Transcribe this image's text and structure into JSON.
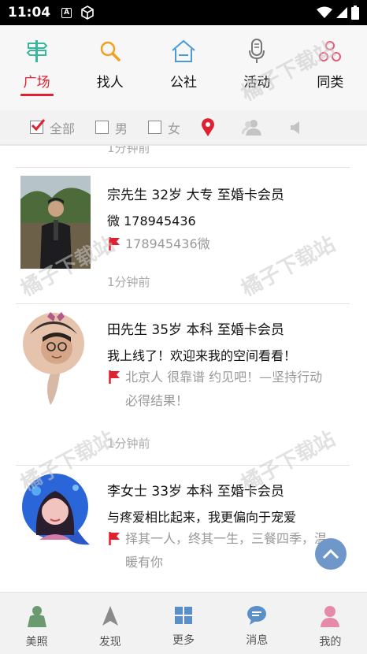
{
  "status": {
    "time": "11:04",
    "a_badge": "A"
  },
  "top_tabs": [
    {
      "label": "广场",
      "icon": "signpost-icon",
      "active": true
    },
    {
      "label": "找人",
      "icon": "magnifier-icon",
      "active": false
    },
    {
      "label": "公社",
      "icon": "house-icon",
      "active": false
    },
    {
      "label": "活动",
      "icon": "microphone-icon",
      "active": false
    },
    {
      "label": "同类",
      "icon": "people-link-icon",
      "active": false
    }
  ],
  "filters": {
    "all": "全部",
    "male": "男",
    "female": "女"
  },
  "feed": {
    "prev_time": "1分钟前",
    "posts": [
      {
        "title": "宗先生  32岁  大专  至婚卡会员",
        "line": "微 178945436",
        "flag_text": "178945436微",
        "time": "1分钟前"
      },
      {
        "title": "田先生  35岁  本科  至婚卡会员",
        "line": "我上线了！欢迎来我的空间看看！",
        "flag_text": "北京人  很靠谱   约见吧！—坚持行动必得结果！",
        "time": "1分钟前"
      },
      {
        "title": "李女士  33岁  本科  至婚卡会员",
        "line": "与疼爱相比起来，我更偏向于宠爱",
        "flag_text": "择其一人，终其一生，三餐四季，温暖有你"
      }
    ]
  },
  "bottom_nav": [
    {
      "label": "美照",
      "icon": "person-icon",
      "color": "#6a9a6e"
    },
    {
      "label": "发现",
      "icon": "compass-arrow-icon",
      "color": "#8a8a8a"
    },
    {
      "label": "更多",
      "icon": "grid-icon",
      "color": "#5b8fc8"
    },
    {
      "label": "消息",
      "icon": "chat-bubble-icon",
      "color": "#5b8fc8"
    },
    {
      "label": "我的",
      "icon": "user-icon",
      "color": "#e58aa8"
    }
  ],
  "watermark": "橘子下载站",
  "colors": {
    "accent": "#e0212f",
    "blue": "#5b8fc8"
  }
}
